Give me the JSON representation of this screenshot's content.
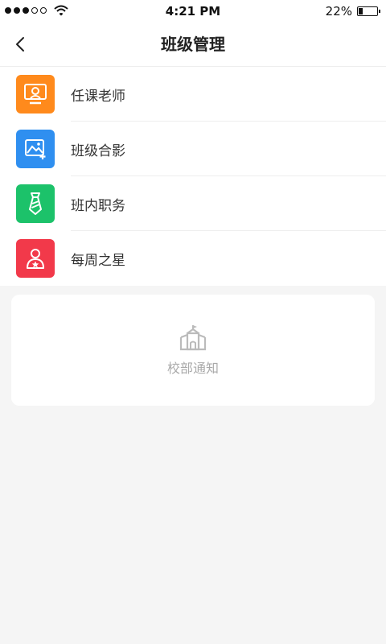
{
  "status_bar": {
    "time": "4:21 PM",
    "battery_percent_text": "22%",
    "battery_level": 0.22,
    "signal_dots_filled": 3,
    "signal_dots_total": 5
  },
  "nav": {
    "title": "班级管理",
    "back_icon": "chevron-left-icon"
  },
  "menu": {
    "items": [
      {
        "label": "任课老师",
        "icon": "teacher-screen-icon",
        "color": "#ff8a1c"
      },
      {
        "label": "班级合影",
        "icon": "photo-add-icon",
        "color": "#2f8ff0"
      },
      {
        "label": "班内职务",
        "icon": "tie-icon",
        "color": "#1cc26a"
      },
      {
        "label": "每周之星",
        "icon": "star-student-icon",
        "color": "#f2394a"
      }
    ]
  },
  "notice": {
    "label": "校部通知",
    "icon": "school-building-icon"
  }
}
